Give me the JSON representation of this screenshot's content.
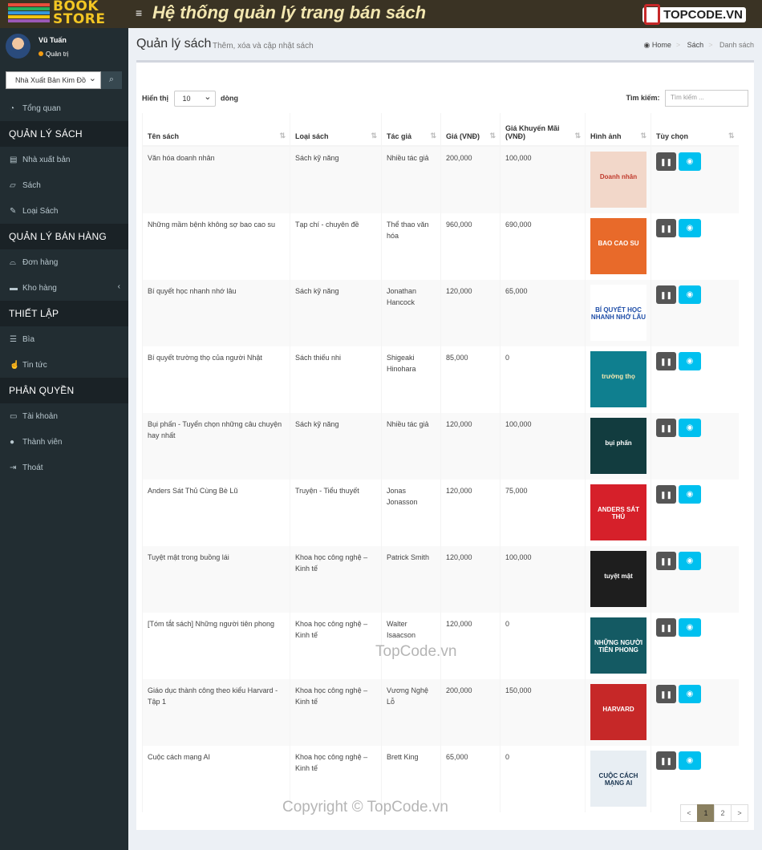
{
  "header": {
    "logo_line1": "BOOK",
    "logo_line2": "STORE",
    "app_title": "Hệ thống quản lý trang bán sách",
    "brand": "TOPCODE.VN",
    "colors": {
      "topbar": "#3a3324",
      "sidebar": "#222d32",
      "accent": "#00c0ef"
    }
  },
  "user": {
    "name": "Vũ Tuấn",
    "role": "Quản trị"
  },
  "sidebar_search": {
    "selected": "Nhà Xuất Bản Kim Đồ",
    "button_icon": "search-icon"
  },
  "menu": {
    "dashboard": "Tổng quan",
    "section_books": "QUẢN LÝ SÁCH",
    "publishers": "Nhà xuất bản",
    "books": "Sách",
    "book_types": "Loại Sách",
    "section_sales": "QUẢN LÝ BÁN HÀNG",
    "orders": "Đơn hàng",
    "warehouse": "Kho hàng",
    "section_settings": "THIẾT LẬP",
    "covers": "Bìa",
    "news": "Tin tức",
    "section_perm": "PHÂN QUYỀN",
    "accounts": "Tài khoản",
    "members": "Thành viên",
    "logout": "Thoát"
  },
  "page": {
    "title": "Quản lý sách",
    "subtitle": "Thêm, xóa và cập nhật sách",
    "breadcrumb": [
      "Home",
      "Sách",
      "Danh sách"
    ]
  },
  "table_controls": {
    "show_label": "Hiển thị",
    "page_size": "10",
    "rows_label": "dòng",
    "search_label": "Tìm kiếm:",
    "search_placeholder": "Tìm kiếm ..."
  },
  "columns": [
    "Tên sách",
    "Loại sách",
    "Tác giả",
    "Giá (VNĐ)",
    "Giá Khuyến Mãi (VNĐ)",
    "Hình ảnh",
    "Tùy chọn"
  ],
  "rows": [
    {
      "name": "Văn hóa doanh nhân",
      "type": "Sách kỹ năng",
      "author": "Nhiều tác giả",
      "price": "200,000",
      "sale": "100,000",
      "cover_text": "Doanh nhân",
      "cover_bg": "#f2d7c9",
      "cover_fg": "#c0392b"
    },
    {
      "name": "Những mầm bệnh không sợ bao cao su",
      "type": "Tạp chí - chuyên đề",
      "author": "Thể thao văn hóa",
      "price": "960,000",
      "sale": "690,000",
      "cover_text": "BAO CAO SU",
      "cover_bg": "#e86a2a",
      "cover_fg": "#ffffff"
    },
    {
      "name": "Bí quyết học nhanh nhớ lâu",
      "type": "Sách kỹ năng",
      "author": "Jonathan Hancock",
      "price": "120,000",
      "sale": "65,000",
      "cover_text": "BÍ QUYẾT HỌC NHANH NHỚ LÂU",
      "cover_bg": "#ffffff",
      "cover_fg": "#1f4ea8"
    },
    {
      "name": "Bí quyết trường thọ của người Nhật",
      "type": "Sách thiếu nhi",
      "author": "Shigeaki Hinohara",
      "price": "85,000",
      "sale": "0",
      "cover_text": "trường thọ",
      "cover_bg": "#0f7f8f",
      "cover_fg": "#f3e7b0"
    },
    {
      "name": "Bụi phấn - Tuyển chọn những câu chuyện hay nhất",
      "type": "Sách kỹ năng",
      "author": "Nhiều tác giả",
      "price": "120,000",
      "sale": "100,000",
      "cover_text": "bụi phấn",
      "cover_bg": "#123c3f",
      "cover_fg": "#ffffff"
    },
    {
      "name": "Anders Sát Thủ Cùng Bè Lũ",
      "type": "Truyện - Tiểu thuyết",
      "author": "Jonas Jonasson",
      "price": "120,000",
      "sale": "75,000",
      "cover_text": "ANDERS SÁT THỦ",
      "cover_bg": "#d6202a",
      "cover_fg": "#ffffff"
    },
    {
      "name": "Tuyệt mật trong buồng lái",
      "type": "Khoa học công nghệ – Kinh tế",
      "author": "Patrick Smith",
      "price": "120,000",
      "sale": "100,000",
      "cover_text": "tuyệt mật",
      "cover_bg": "#1e1e1e",
      "cover_fg": "#ffffff"
    },
    {
      "name": "[Tóm tắt sách] Những người tiên phong",
      "type": "Khoa học công nghệ – Kinh tế",
      "author": "Walter Isaacson",
      "price": "120,000",
      "sale": "0",
      "cover_text": "NHỮNG NGƯỜI TIÊN PHONG",
      "cover_bg": "#145a63",
      "cover_fg": "#ffffff"
    },
    {
      "name": "Giáo dục thành công theo kiểu Harvard - Tập 1",
      "type": "Khoa học công nghệ – Kinh tế",
      "author": "Vương Nghệ Lỗ",
      "price": "200,000",
      "sale": "150,000",
      "cover_text": "HARVARD",
      "cover_bg": "#c62828",
      "cover_fg": "#ffffff"
    },
    {
      "name": "Cuộc cách mạng AI",
      "type": "Khoa học công nghệ – Kinh tế",
      "author": "Brett King",
      "price": "65,000",
      "sale": "0",
      "cover_text": "CUỘC CÁCH MẠNG AI",
      "cover_bg": "#e8eef3",
      "cover_fg": "#1a3550"
    }
  ],
  "pagination": {
    "prev": "<",
    "pages": [
      "1",
      "2"
    ],
    "next": ">"
  },
  "watermarks": {
    "mid": "TopCode.vn",
    "bottom": "Copyright © TopCode.vn"
  }
}
